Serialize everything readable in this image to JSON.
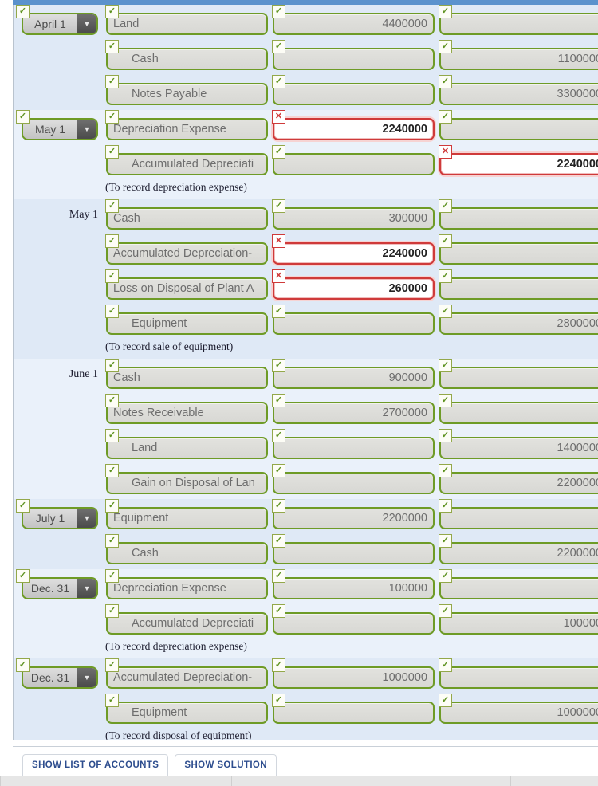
{
  "icons": {
    "check": "✓",
    "x": "✕",
    "caret": "▼"
  },
  "footer": {
    "buttons": [
      {
        "label": "SHOW LIST OF ACCOUNTS",
        "name": "show-list-of-accounts-button"
      },
      {
        "label": "SHOW SOLUTION",
        "name": "show-solution-button"
      }
    ]
  },
  "entries": [
    {
      "date": {
        "type": "select",
        "value": "April 1"
      },
      "lines": [
        {
          "account": "Land",
          "indent": false,
          "debit": "4400000",
          "credit": "",
          "debit_error": false,
          "credit_error": false
        },
        {
          "account": "Cash",
          "indent": true,
          "debit": "",
          "credit": "1100000",
          "debit_error": false,
          "credit_error": false
        },
        {
          "account": "Notes Payable",
          "indent": true,
          "debit": "",
          "credit": "3300000",
          "debit_error": false,
          "credit_error": false
        }
      ],
      "memo": ""
    },
    {
      "date": {
        "type": "select",
        "value": "May 1"
      },
      "lines": [
        {
          "account": "Depreciation Expense",
          "indent": false,
          "debit": "2240000",
          "credit": "",
          "debit_error": true,
          "credit_error": false
        },
        {
          "account": "Accumulated Depreciati",
          "indent": true,
          "debit": "",
          "credit": "2240000",
          "debit_error": false,
          "credit_error": true
        }
      ],
      "memo": "(To record depreciation expense)"
    },
    {
      "date": {
        "type": "text",
        "value": "May 1"
      },
      "lines": [
        {
          "account": "Cash",
          "indent": false,
          "debit": "300000",
          "credit": "",
          "debit_error": false,
          "credit_error": false
        },
        {
          "account": "Accumulated Depreciation-",
          "indent": false,
          "debit": "2240000",
          "credit": "",
          "debit_error": true,
          "credit_error": false
        },
        {
          "account": "Loss on Disposal of Plant A",
          "indent": false,
          "debit": "260000",
          "credit": "",
          "debit_error": true,
          "credit_error": false
        },
        {
          "account": "Equipment",
          "indent": true,
          "debit": "",
          "credit": "2800000",
          "debit_error": false,
          "credit_error": false
        }
      ],
      "memo": "(To record sale of equipment)"
    },
    {
      "date": {
        "type": "text",
        "value": "June 1"
      },
      "lines": [
        {
          "account": "Cash",
          "indent": false,
          "debit": "900000",
          "credit": "",
          "debit_error": false,
          "credit_error": false
        },
        {
          "account": "Notes Receivable",
          "indent": false,
          "debit": "2700000",
          "credit": "",
          "debit_error": false,
          "credit_error": false
        },
        {
          "account": "Land",
          "indent": true,
          "debit": "",
          "credit": "1400000",
          "debit_error": false,
          "credit_error": false
        },
        {
          "account": "Gain on Disposal of Lan",
          "indent": true,
          "debit": "",
          "credit": "2200000",
          "debit_error": false,
          "credit_error": false
        }
      ],
      "memo": ""
    },
    {
      "date": {
        "type": "select",
        "value": "July 1"
      },
      "lines": [
        {
          "account": "Equipment",
          "indent": false,
          "debit": "2200000",
          "credit": "",
          "debit_error": false,
          "credit_error": false
        },
        {
          "account": "Cash",
          "indent": true,
          "debit": "",
          "credit": "2200000",
          "debit_error": false,
          "credit_error": false
        }
      ],
      "memo": ""
    },
    {
      "date": {
        "type": "select",
        "value": "Dec. 31"
      },
      "lines": [
        {
          "account": "Depreciation Expense",
          "indent": false,
          "debit": "100000",
          "credit": "",
          "debit_error": false,
          "credit_error": false
        },
        {
          "account": "Accumulated Depreciati",
          "indent": true,
          "debit": "",
          "credit": "100000",
          "debit_error": false,
          "credit_error": false
        }
      ],
      "memo": "(To record depreciation expense)"
    },
    {
      "date": {
        "type": "select",
        "value": "Dec. 31"
      },
      "lines": [
        {
          "account": "Accumulated Depreciation-",
          "indent": false,
          "debit": "1000000",
          "credit": "",
          "debit_error": false,
          "credit_error": false
        },
        {
          "account": "Equipment",
          "indent": true,
          "debit": "",
          "credit": "1000000",
          "debit_error": false,
          "credit_error": false
        }
      ],
      "memo": "(To record disposal of equipment)"
    }
  ]
}
